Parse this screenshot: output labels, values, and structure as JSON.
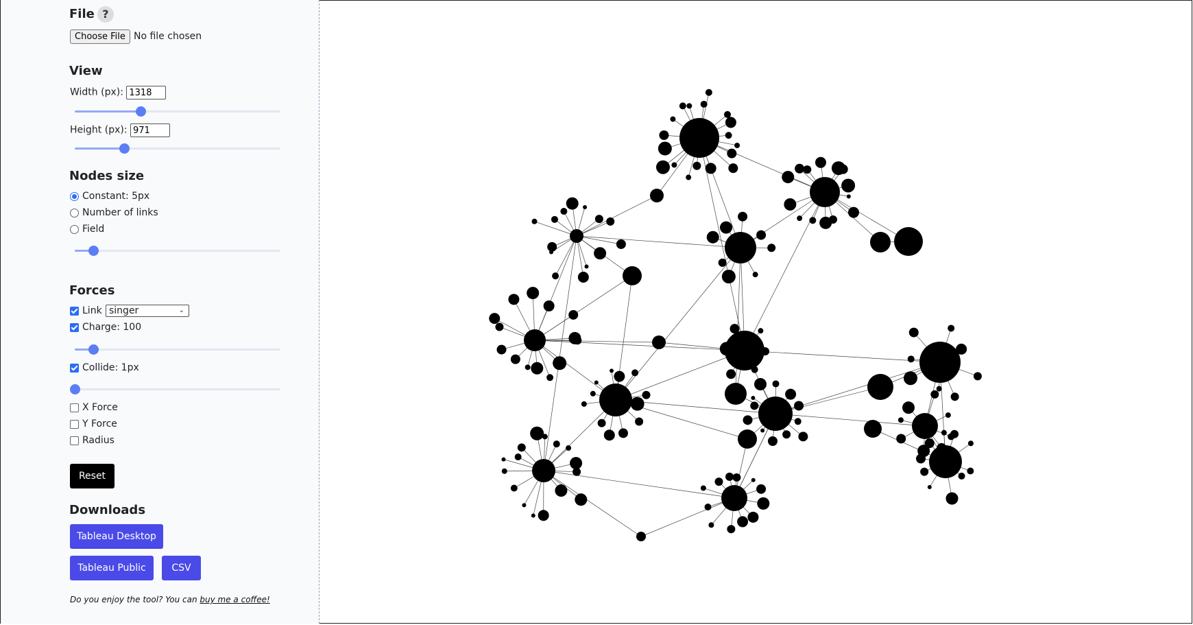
{
  "file": {
    "heading": "File",
    "help_icon": "?",
    "choose_label": "Choose File",
    "status": "No file chosen"
  },
  "view": {
    "heading": "View",
    "width_label": "Width (px):",
    "width_value": "1318",
    "width_slider_fraction": 0.32,
    "height_label": "Height (px):",
    "height_value": "971",
    "height_slider_fraction": 0.24
  },
  "nodes_size": {
    "heading": "Nodes size",
    "options": [
      "Constant: 5px",
      "Number of links",
      "Field"
    ],
    "selected": "Constant: 5px",
    "slider_fraction": 0.09
  },
  "forces": {
    "heading": "Forces",
    "link_label": "Link",
    "link_checked": true,
    "link_select_value": "singer",
    "charge_label": "Charge: 100",
    "charge_checked": true,
    "charge_slider_fraction": 0.09,
    "collide_label": "Collide: 1px",
    "collide_checked": true,
    "collide_slider_fraction": 0.0,
    "x_force_label": "X Force",
    "y_force_label": "Y Force",
    "radius_label": "Radius"
  },
  "reset_label": "Reset",
  "downloads": {
    "heading": "Downloads",
    "tableau_desktop_label": "Tableau Desktop",
    "tableau_public_label": "Tableau Public",
    "csv_label": "CSV"
  },
  "footer": {
    "prefix": "Do you enjoy the tool? You can ",
    "link": "buy me a coffee!"
  },
  "colors": {
    "accent": "#5b7ef5",
    "download_button": "#4a4ae8",
    "node": "#000000"
  }
}
